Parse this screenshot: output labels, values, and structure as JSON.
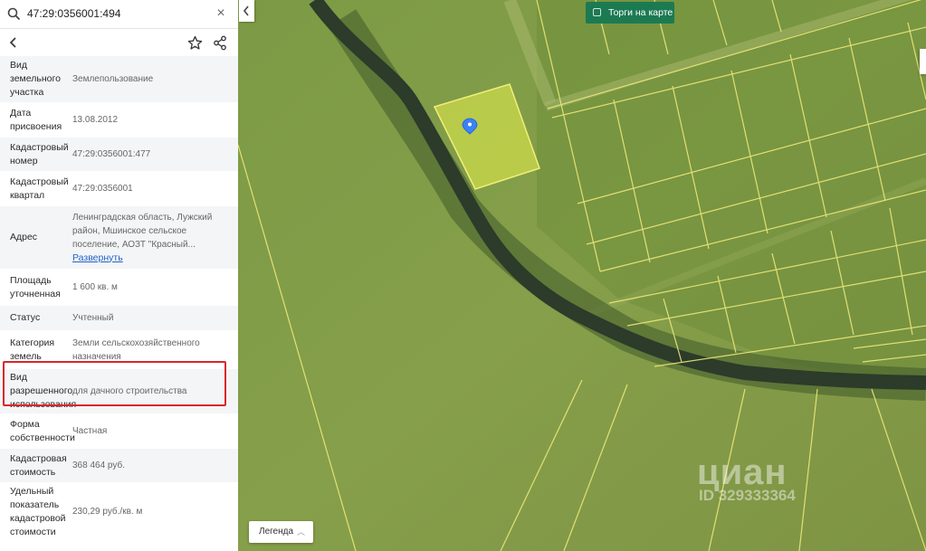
{
  "search": {
    "value": "47:29:0356001:494",
    "clear_label": "×"
  },
  "details": [
    {
      "label": "Вид земельного участка",
      "value": "Землепользование"
    },
    {
      "label": "Дата присвоения",
      "value": "13.08.2012"
    },
    {
      "label": "Кадастровый номер",
      "value": "47:29:0356001:477"
    },
    {
      "label": "Кадастровый квартал",
      "value": "47:29:0356001"
    },
    {
      "label": "Адрес",
      "value": "Ленинградская область, Лужский район, Мшинское сельское поселение, АОЗТ \"Красный...",
      "link": "Развернуть"
    },
    {
      "label": "Площадь уточненная",
      "value": "1 600 кв. м"
    },
    {
      "label": "Статус",
      "value": "Учтенный"
    },
    {
      "label": "Категория земель",
      "value": "Земли сельскохозяйственного назначения"
    },
    {
      "label": "Вид разрешенного использования",
      "value": "для дачного строительства"
    },
    {
      "label": "Форма собственности",
      "value": "Частная"
    },
    {
      "label": "Кадастровая стоимость",
      "value": "368 464 руб."
    },
    {
      "label": "Удельный показатель кадастровой стоимости",
      "value": "230,29 руб./кв. м"
    }
  ],
  "map": {
    "torgi_label": "Торги на карте",
    "legend_label": "Легенда",
    "watermark": "циан",
    "watermark_id": "ID 329333364",
    "colors": {
      "parcel_fill": "#e8f04c",
      "parcel_line": "#f2ee7a",
      "river": "#2c3b2a",
      "highlight": "#d9262c",
      "accent": "#1c7a52"
    }
  }
}
